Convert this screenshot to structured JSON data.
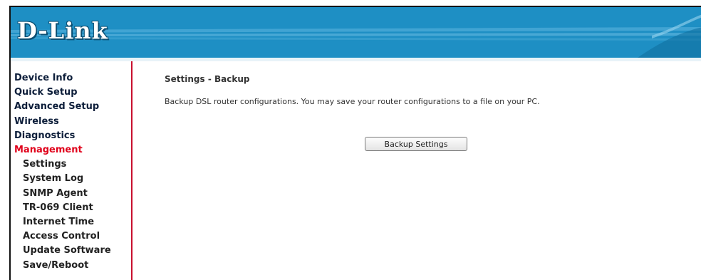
{
  "header": {
    "logo_text": "D-Link",
    "banner_color": "#1e8fc4",
    "accent_color": "#c8102e"
  },
  "sidebar": {
    "items": [
      {
        "label": "Device Info",
        "level": 1,
        "active": false
      },
      {
        "label": "Quick Setup",
        "level": 1,
        "active": false
      },
      {
        "label": "Advanced Setup",
        "level": 1,
        "active": false
      },
      {
        "label": "Wireless",
        "level": 1,
        "active": false
      },
      {
        "label": "Diagnostics",
        "level": 1,
        "active": false
      },
      {
        "label": "Management",
        "level": 1,
        "active": true
      },
      {
        "label": "Settings",
        "level": 2,
        "active": false
      },
      {
        "label": "System Log",
        "level": 2,
        "active": false
      },
      {
        "label": "SNMP Agent",
        "level": 2,
        "active": false
      },
      {
        "label": "TR-069 Client",
        "level": 2,
        "active": false
      },
      {
        "label": "Internet Time",
        "level": 2,
        "active": false
      },
      {
        "label": "Access Control",
        "level": 2,
        "active": false
      },
      {
        "label": "Update Software",
        "level": 2,
        "active": false
      },
      {
        "label": "Save/Reboot",
        "level": 2,
        "active": false
      }
    ]
  },
  "main": {
    "title": "Settings - Backup",
    "description": "Backup DSL router configurations. You may save your router configurations to a file on your PC.",
    "backup_button_label": "Backup Settings"
  }
}
